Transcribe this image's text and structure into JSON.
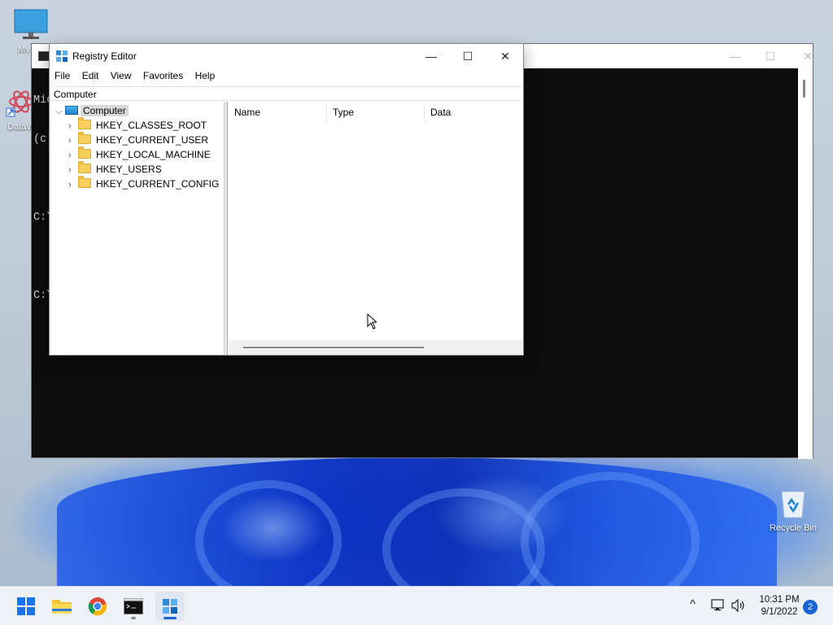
{
  "desktop": {
    "icons": [
      {
        "label": "My Co",
        "icon": "monitor-icon"
      },
      {
        "label": "DataW",
        "icon": "datawrapper-icon"
      },
      {
        "label": "Recycle Bin",
        "icon": "recycle-bin-icon"
      }
    ]
  },
  "console": {
    "lines": [
      "Mic",
      "(c)",
      "",
      "C:\\",
      "",
      "C:\\"
    ],
    "controls": {
      "minimize": "—",
      "maximize": "☐",
      "close": "✕"
    }
  },
  "regedit": {
    "title": "Registry Editor",
    "controls": {
      "minimize": "—",
      "maximize": "☐",
      "close": "✕"
    },
    "menu": [
      "File",
      "Edit",
      "View",
      "Favorites",
      "Help"
    ],
    "address": "Computer",
    "tree": {
      "root": "Computer",
      "children": [
        "HKEY_CLASSES_ROOT",
        "HKEY_CURRENT_USER",
        "HKEY_LOCAL_MACHINE",
        "HKEY_USERS",
        "HKEY_CURRENT_CONFIG"
      ]
    },
    "columns": [
      "Name",
      "Type",
      "Data"
    ]
  },
  "taskbar": {
    "apps": [
      {
        "name": "start",
        "icon": "windows-logo-icon"
      },
      {
        "name": "file-explorer",
        "icon": "folder-icon"
      },
      {
        "name": "chrome",
        "icon": "chrome-icon"
      },
      {
        "name": "terminal",
        "icon": "terminal-icon"
      },
      {
        "name": "registry-editor",
        "icon": "regedit-icon"
      }
    ],
    "tray": {
      "chevron": "^",
      "time": "10:31 PM",
      "date": "9/1/2022",
      "notifications": "2"
    }
  },
  "colors": {
    "accent": "#1b64d6",
    "console_bg": "#0c0c0c",
    "folder": "#f7cf5d"
  }
}
